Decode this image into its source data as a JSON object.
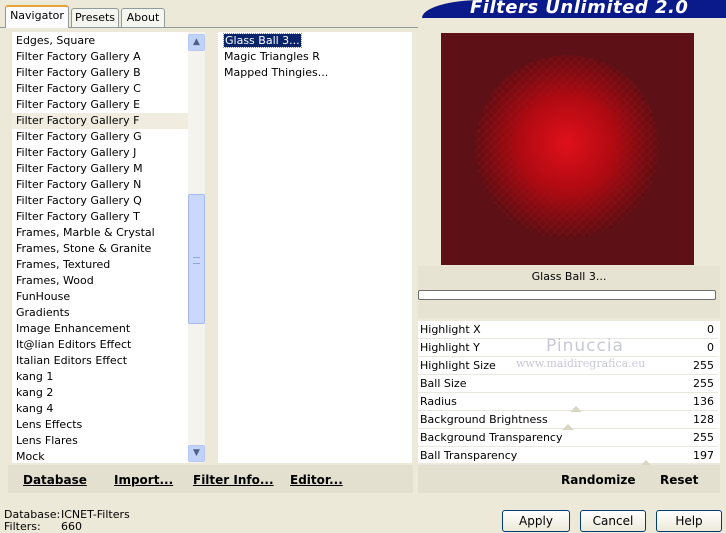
{
  "tabs": [
    {
      "label": "Navigator",
      "active": true
    },
    {
      "label": "Presets",
      "active": false
    },
    {
      "label": "About",
      "active": false
    }
  ],
  "banner": {
    "title": "Filters Unlimited 2.0"
  },
  "categories": [
    {
      "label": "Edges, Square"
    },
    {
      "label": "Filter Factory Gallery A"
    },
    {
      "label": "Filter Factory Gallery B"
    },
    {
      "label": "Filter Factory Gallery C"
    },
    {
      "label": "Filter Factory Gallery E"
    },
    {
      "label": "Filter Factory Gallery F",
      "highlighted": true
    },
    {
      "label": "Filter Factory Gallery G"
    },
    {
      "label": "Filter Factory Gallery J"
    },
    {
      "label": "Filter Factory Gallery M"
    },
    {
      "label": "Filter Factory Gallery N"
    },
    {
      "label": "Filter Factory Gallery Q"
    },
    {
      "label": "Filter Factory Gallery T"
    },
    {
      "label": "Frames, Marble & Crystal"
    },
    {
      "label": "Frames, Stone & Granite"
    },
    {
      "label": "Frames, Textured"
    },
    {
      "label": "Frames, Wood"
    },
    {
      "label": "FunHouse"
    },
    {
      "label": "Gradients"
    },
    {
      "label": "Image Enhancement"
    },
    {
      "label": "It@lian Editors Effect"
    },
    {
      "label": "Italian Editors Effect"
    },
    {
      "label": "kang 1"
    },
    {
      "label": "kang 2"
    },
    {
      "label": "kang 4"
    },
    {
      "label": "Lens Effects"
    },
    {
      "label": "Lens Flares"
    },
    {
      "label": "Mock"
    }
  ],
  "filters": [
    {
      "label": "Glass Ball 3...",
      "selected": true
    },
    {
      "label": "Magic Triangles R"
    },
    {
      "label": "Mapped Thingies..."
    }
  ],
  "left_buttons": {
    "database": "Database",
    "import": "Import...",
    "filter_info": "Filter Info...",
    "editor": "Editor..."
  },
  "preview": {
    "caption": "Glass Ball 3...",
    "progress": 0
  },
  "params": [
    {
      "label": "Highlight X",
      "value": "0"
    },
    {
      "label": "Highlight Y",
      "value": "0"
    },
    {
      "label": "Highlight Size",
      "value": "255"
    },
    {
      "label": "Ball Size",
      "value": "255"
    },
    {
      "label": "Radius",
      "value": "136"
    },
    {
      "label": "Background Brightness",
      "value": "128"
    },
    {
      "label": "Background Transparency",
      "value": "255"
    },
    {
      "label": "Ball Transparency",
      "value": "197"
    }
  ],
  "right_buttons": {
    "randomize": "Randomize",
    "reset": "Reset"
  },
  "watermark": {
    "name": "Pinuccia",
    "site": "www.maidiregrafica.eu"
  },
  "status": {
    "database_label": "Database:",
    "database_value": "ICNET-Filters",
    "filters_label": "Filters:",
    "filters_value": "660"
  },
  "dialog_buttons": {
    "apply": "Apply",
    "cancel": "Cancel",
    "help": "Help"
  },
  "colors": {
    "banner": "#0a1a8a",
    "selection": "#0a246a",
    "preview_bg": "#5d1116",
    "ball": "#e0101a"
  }
}
